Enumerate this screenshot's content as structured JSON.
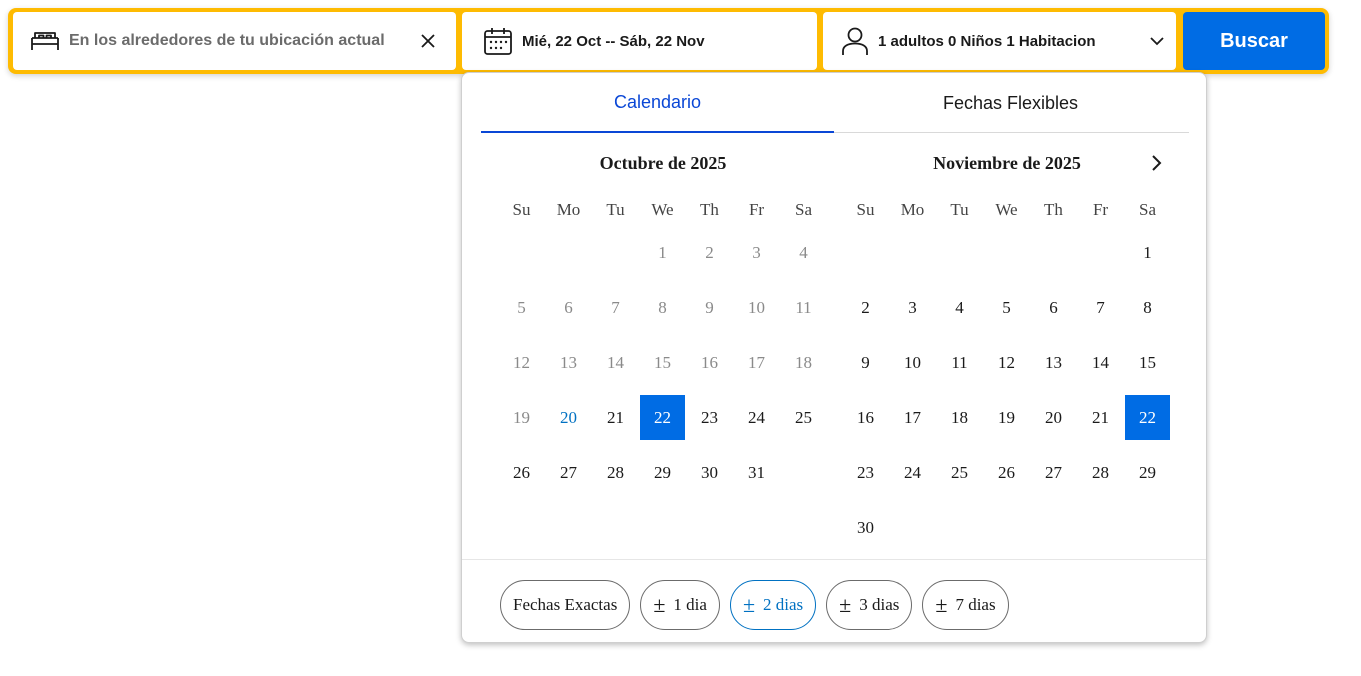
{
  "search": {
    "destination": "En los alrededores de tu ubicación actual",
    "dates": "Mié, 22 Oct -- Sáb, 22 Nov",
    "occupancy": "1 adultos 0 Niños 1 Habitacion",
    "search_label": "Buscar"
  },
  "tabs": {
    "calendar": "Calendario",
    "flexible": "Fechas Flexibles"
  },
  "weekdays": [
    "Su",
    "Mo",
    "Tu",
    "We",
    "Th",
    "Fr",
    "Sa"
  ],
  "months": [
    {
      "title": "Octubre de 2025",
      "weeks": [
        [
          "",
          "",
          "",
          "1",
          "2",
          "3",
          "4"
        ],
        [
          "5",
          "6",
          "7",
          "8",
          "9",
          "10",
          "11"
        ],
        [
          "12",
          "13",
          "14",
          "15",
          "16",
          "17",
          "18"
        ],
        [
          "19",
          "20",
          "21",
          "22",
          "23",
          "24",
          "25"
        ],
        [
          "26",
          "27",
          "28",
          "29",
          "30",
          "31",
          ""
        ]
      ],
      "past_through": 19,
      "today": 20,
      "selected": 22
    },
    {
      "title": "Noviembre de 2025",
      "weeks": [
        [
          "",
          "",
          "",
          "",
          "",
          "",
          "1"
        ],
        [
          "2",
          "3",
          "4",
          "5",
          "6",
          "7",
          "8"
        ],
        [
          "9",
          "10",
          "11",
          "12",
          "13",
          "14",
          "15"
        ],
        [
          "16",
          "17",
          "18",
          "19",
          "20",
          "21",
          "22"
        ],
        [
          "23",
          "24",
          "25",
          "26",
          "27",
          "28",
          "29"
        ],
        [
          "30",
          "",
          "",
          "",
          "",
          "",
          ""
        ]
      ],
      "past_through": 0,
      "today": null,
      "selected": 22
    }
  ],
  "flex_options": [
    {
      "label": "Fechas Exactas",
      "plusminus": ""
    },
    {
      "label": "1 dia",
      "plusminus": "±"
    },
    {
      "label": "2 dias",
      "plusminus": "±"
    },
    {
      "label": "3 dias",
      "plusminus": "±"
    },
    {
      "label": "7 dias",
      "plusminus": "±"
    }
  ],
  "active_flex_index": 2,
  "colors": {
    "brand_yellow": "#febb02",
    "primary_blue": "#006ce4",
    "tab_active": "#0a47d6",
    "today_text": "#0071c2"
  }
}
